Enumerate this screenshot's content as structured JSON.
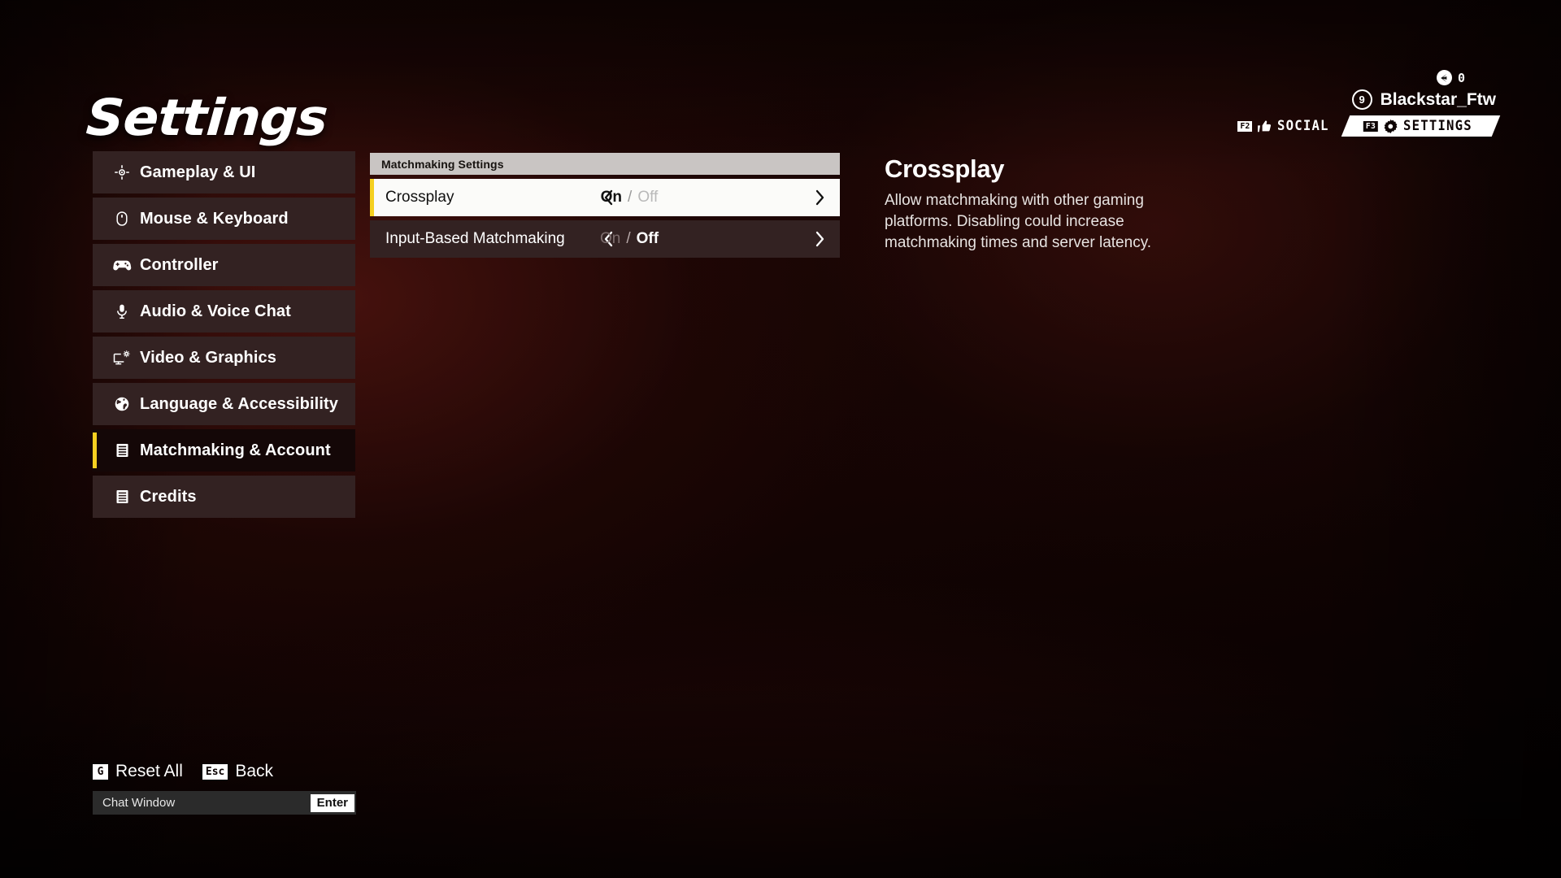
{
  "page": {
    "title": "Settings",
    "accent_color": "#f5d020",
    "panel_bg": "#332222",
    "selected_row_bg": "#fbfbf9",
    "header_bg": "#c9c5c3"
  },
  "sidebar": {
    "items": [
      {
        "label": "Gameplay & UI",
        "icon": "crosshair-icon",
        "selected": false
      },
      {
        "label": "Mouse & Keyboard",
        "icon": "mouse-icon",
        "selected": false
      },
      {
        "label": "Controller",
        "icon": "gamepad-icon",
        "selected": false
      },
      {
        "label": "Audio & Voice Chat",
        "icon": "microphone-icon",
        "selected": false
      },
      {
        "label": "Video & Graphics",
        "icon": "monitor-gear-icon",
        "selected": false
      },
      {
        "label": "Language & Accessibility",
        "icon": "globe-icon",
        "selected": false
      },
      {
        "label": "Matchmaking & Account",
        "icon": "list-icon",
        "selected": true
      },
      {
        "label": "Credits",
        "icon": "list-icon",
        "selected": false
      }
    ]
  },
  "panel": {
    "header": "Matchmaking Settings",
    "options": [
      {
        "label": "Crossplay",
        "values": [
          "On",
          "Off"
        ],
        "selected_value": "On",
        "selected": true,
        "left_arrow": "chevron-left-icon",
        "right_arrow": "chevron-right-icon"
      },
      {
        "label": "Input-Based Matchmaking",
        "values": [
          "On",
          "Off"
        ],
        "selected_value": "Off",
        "selected": false,
        "left_arrow": "chevron-left-icon",
        "right_arrow": "chevron-right-icon"
      }
    ],
    "value_separator": "/"
  },
  "description": {
    "title": "Crossplay",
    "body": "Allow matchmaking with other gaming platforms. Disabling could increase matchmaking times and server latency."
  },
  "hud": {
    "currency": {
      "icon": "currency-coin-icon",
      "amount": "0"
    },
    "player": {
      "level": "9",
      "name": "Blackstar_Ftw"
    },
    "tabs": [
      {
        "key": "F2",
        "label": "SOCIAL",
        "icon": "thumbs-up-icon",
        "active": false
      },
      {
        "key": "F3",
        "label": "SETTINGS",
        "icon": "gear-icon",
        "active": true
      }
    ]
  },
  "footer": {
    "hints": [
      {
        "key": "G",
        "label": "Reset All"
      },
      {
        "key": "Esc",
        "label": "Back"
      }
    ],
    "chat": {
      "label": "Chat Window",
      "key": "Enter"
    }
  }
}
